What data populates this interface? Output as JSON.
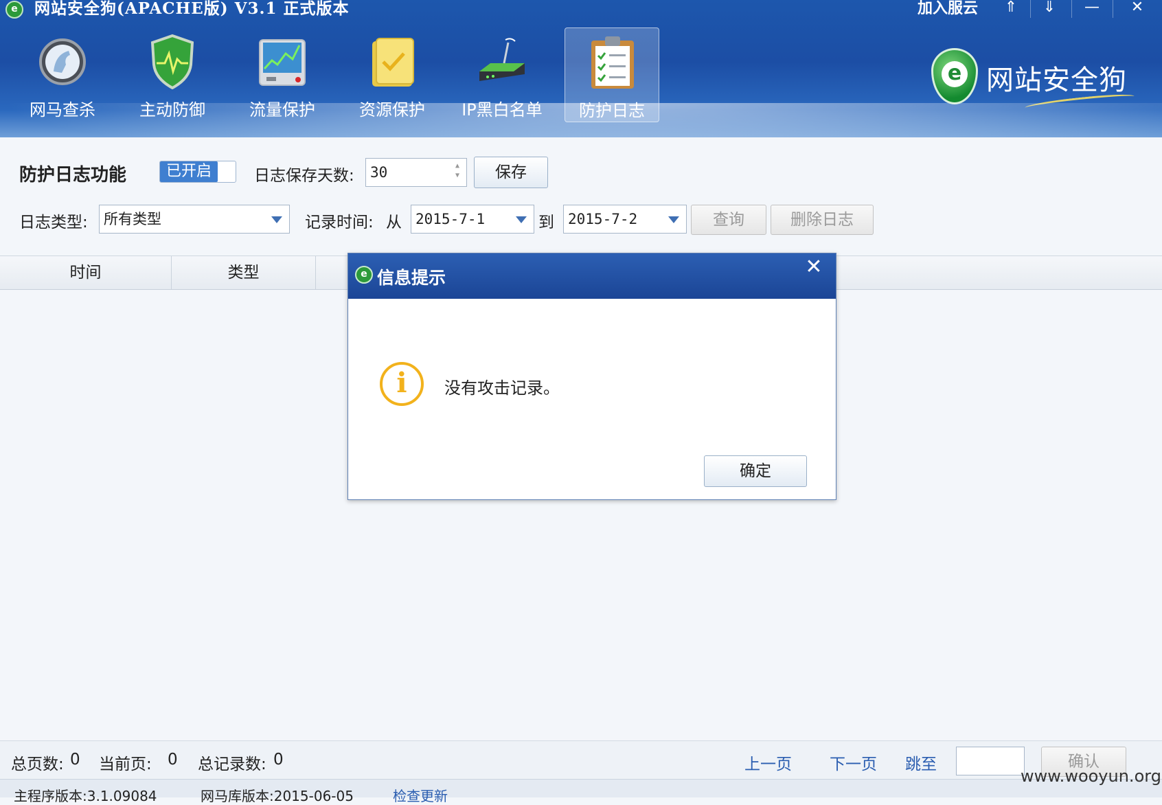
{
  "app": {
    "title": "网站安全狗(APACHE版) V3.1 正式版本",
    "cloud_link": "加入服云",
    "brand_name": "网站安全狗"
  },
  "window_controls": {
    "pin": "⇑",
    "menu": "⇓",
    "minimize": "—",
    "close": "✕"
  },
  "toolbar": {
    "items": [
      {
        "label": "网马查杀",
        "icon": "horse-scan-icon"
      },
      {
        "label": "主动防御",
        "icon": "shield-icon"
      },
      {
        "label": "流量保护",
        "icon": "traffic-monitor-icon"
      },
      {
        "label": "资源保护",
        "icon": "folder-icon"
      },
      {
        "label": "IP黑白名单",
        "icon": "router-icon"
      },
      {
        "label": "防护日志",
        "icon": "clipboard-icon",
        "active": true
      }
    ]
  },
  "log_settings": {
    "title": "防护日志功能",
    "toggle_label": "已开启",
    "retain_label": "日志保存天数:",
    "retain_days": "30",
    "save_button": "保存"
  },
  "filters": {
    "type_label": "日志类型:",
    "type_value": "所有类型",
    "time_label": "记录时间:",
    "from_label": "从",
    "from_date": "2015-7-1",
    "to_label": "到",
    "to_date": "2015-7-2",
    "query_button": "查询",
    "delete_button": "删除日志"
  },
  "table": {
    "columns": [
      "时间",
      "类型"
    ]
  },
  "pager": {
    "total_pages_label": "总页数:",
    "total_pages": "0",
    "current_page_label": "当前页:",
    "current_page": "0",
    "total_records_label": "总记录数:",
    "total_records": "0",
    "prev": "上一页",
    "next": "下一页",
    "jump": "跳至",
    "confirm": "确认"
  },
  "statusbar": {
    "main_version": "主程序版本:3.1.09084",
    "virus_db_version": "网马库版本:2015-06-05",
    "check_update": "检查更新"
  },
  "watermark": "www.wooyun.org",
  "dialog": {
    "title": "信息提示",
    "close": "✕",
    "icon_glyph": "i",
    "message": "没有攻击记录。",
    "ok_button": "确定"
  },
  "colors": {
    "header_blue": "#1c4ea5",
    "accent_blue": "#3f7fd0",
    "info_orange": "#f2b21c",
    "brand_green": "#2c9a3a"
  }
}
